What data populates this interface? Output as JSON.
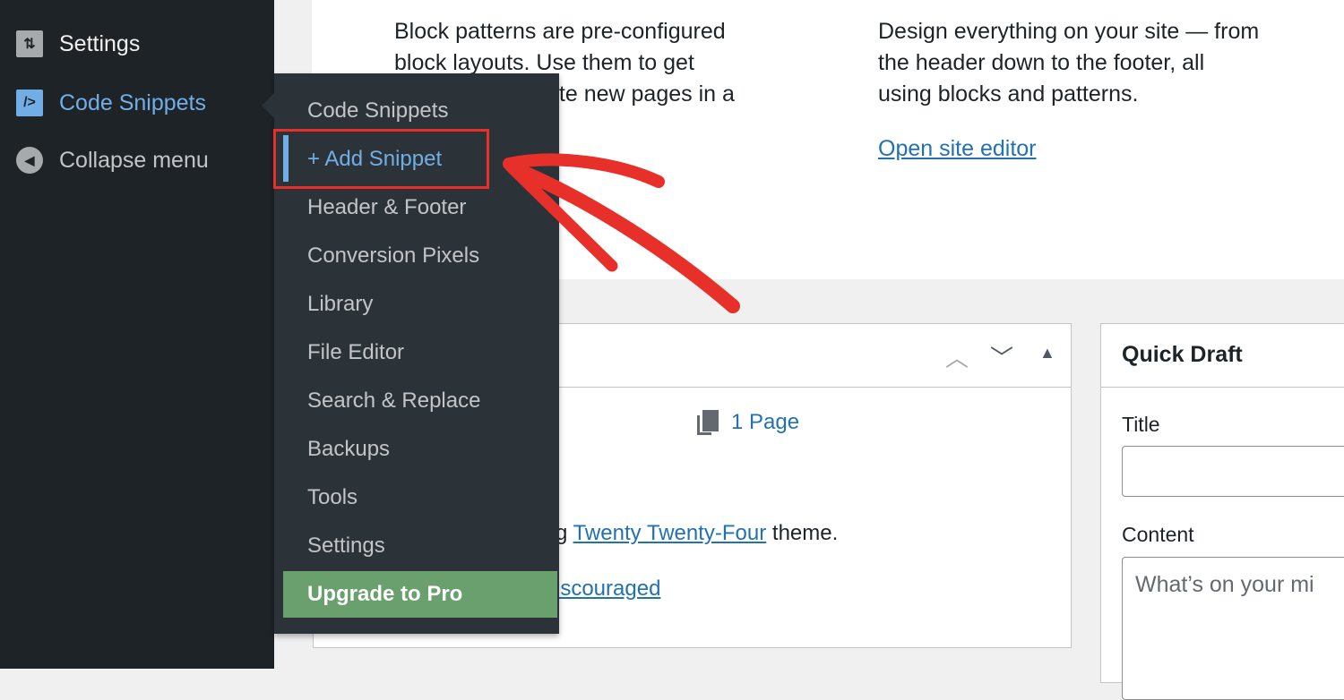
{
  "sidebar": {
    "items": [
      {
        "label": "Settings",
        "icon": "settings-sliders-icon"
      },
      {
        "label": "Code Snippets",
        "icon": "code-icon",
        "active": true
      },
      {
        "label": "Collapse menu",
        "icon": "collapse-arrow-icon"
      }
    ]
  },
  "flyout": {
    "items": [
      "Code Snippets",
      "+ Add Snippet",
      "Header & Footer",
      "Conversion Pixels",
      "Library",
      "File Editor",
      "Search & Replace",
      "Backups",
      "Tools",
      "Settings"
    ],
    "highlighted": "+ Add Snippet",
    "upgrade": "Upgrade to Pro"
  },
  "welcome": {
    "col1": [
      "Block patterns are pre-configured",
      "block layouts. Use them to get",
      "ate new pages in a"
    ],
    "col2": [
      "Design everything on your site — from",
      "the header down to the footer, all",
      "using blocks and patterns."
    ],
    "col2_link": "Open site editor"
  },
  "glance": {
    "pages": "1 Page",
    "theme_prefix": "g ",
    "theme_link": "Twenty Twenty-Four",
    "theme_suffix": " theme.",
    "search_link": "iscouraged"
  },
  "quick_draft": {
    "title": "Quick Draft",
    "title_label": "Title",
    "title_value": "",
    "content_label": "Content",
    "content_placeholder": "What’s on your mi"
  },
  "colors": {
    "sidebar": "#1d2327",
    "flyout": "#2c3338",
    "accent": "#72aee6",
    "upgrade": "#6a9f6e",
    "annotation": "#e8302a"
  }
}
